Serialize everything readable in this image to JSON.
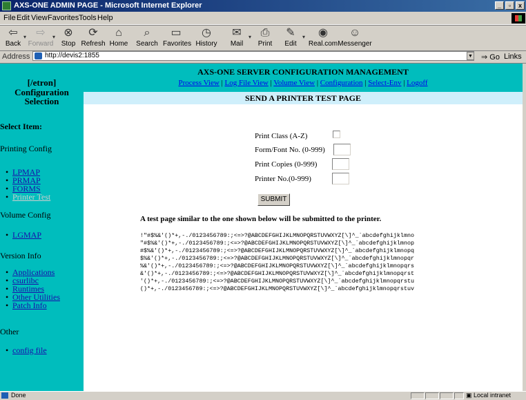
{
  "window": {
    "title": "AXS-ONE ADMIN PAGE - Microsoft Internet Explorer",
    "buttons": [
      "_",
      "▫",
      "x"
    ]
  },
  "menu": [
    "File",
    "Edit",
    "View",
    "Favorites",
    "Tools",
    "Help"
  ],
  "toolbar": {
    "back": "Back",
    "forward": "Forward",
    "stop": "Stop",
    "refresh": "Refresh",
    "home": "Home",
    "search": "Search",
    "favorites": "Favorites",
    "history": "History",
    "mail": "Mail",
    "print": "Print",
    "edit": "Edit",
    "realcom": "Real.com",
    "messenger": "Messenger"
  },
  "address": {
    "label": "Address",
    "url": "http://devis2:1855",
    "go": "Go",
    "links": "Links"
  },
  "sidebar": {
    "user": "[/etron]",
    "heading1": "Configuration",
    "heading2": "Selection",
    "select_item": "Select Item:",
    "sections": {
      "printing": "Printing Config",
      "volume": "Volume Config",
      "version": "Version Info",
      "other": "Other"
    },
    "printing_items": [
      "LPMAP",
      "PRMAP",
      "FORMS",
      "Printer Test"
    ],
    "volume_items": [
      "LGMAP"
    ],
    "version_items": [
      "Applications",
      "csurlibc",
      "Runtimes",
      "Other Utilities",
      "Patch Info"
    ],
    "other_items": [
      "config file"
    ]
  },
  "header": {
    "title": "AXS-ONE SERVER CONFIGURATION MANAGEMENT",
    "nav": [
      "Process View",
      "Log File View",
      "Volume View",
      "Configuration",
      "Select-Env",
      "Logoff"
    ],
    "separator": " | ",
    "page_title": "SEND A PRINTER TEST PAGE"
  },
  "form": {
    "print_class": "Print Class (A-Z)",
    "form_font": "Form/Font No. (0-999)",
    "print_copies": "Print Copies (0-999)",
    "printer_no": "Printer No.(0-999)",
    "submit": "SUBMIT"
  },
  "description": "A test page similar to the one shown below will be submitted to the printer.",
  "sample_lines": [
    "!\"#$%&'()*+,-./0123456789:;<=>?@ABCDEFGHIJKLMNOPQRSTUVWXYZ[\\]^_`abcdefghijklmno",
    "\"#$%&'()*+,-./0123456789:;<=>?@ABCDEFGHIJKLMNOPQRSTUVWXYZ[\\]^_`abcdefghijklmnop",
    "#$%&'()*+,-./0123456789:;<=>?@ABCDEFGHIJKLMNOPQRSTUVWXYZ[\\]^_`abcdefghijklmnopq",
    "$%&'()*+,-./0123456789:;<=>?@ABCDEFGHIJKLMNOPQRSTUVWXYZ[\\]^_`abcdefghijklmnopqr",
    "%&'()*+,-./0123456789:;<=>?@ABCDEFGHIJKLMNOPQRSTUVWXYZ[\\]^_`abcdefghijklmnopqrs",
    "&'()*+,-./0123456789:;<=>?@ABCDEFGHIJKLMNOPQRSTUVWXYZ[\\]^_`abcdefghijklmnopqrst",
    "'()*+,-./0123456789:;<=>?@ABCDEFGHIJKLMNOPQRSTUVWXYZ[\\]^_`abcdefghijklmnopqrstu",
    "()*+,-./0123456789:;<=>?@ABCDEFGHIJKLMNOPQRSTUVWXYZ[\\]^_`abcdefghijklmnopqrstuv"
  ],
  "status": {
    "text": "Done",
    "zone": "Local intranet"
  },
  "colors": {
    "sidebar_bg": "#00bdbd",
    "page_band": "#cfeffb",
    "title_bar": "#0a246a"
  }
}
